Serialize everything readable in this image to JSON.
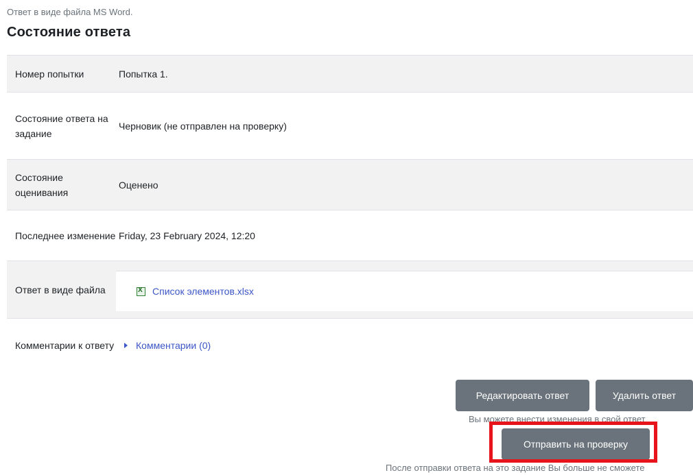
{
  "intro_text": "Ответ в виде файла MS Word.",
  "section_title": "Состояние ответа",
  "rows": {
    "attempt": {
      "label": "Номер попытки",
      "value": "Попытка 1."
    },
    "submission_status": {
      "label": "Состояние ответа на задание",
      "value": "Черновик (не отправлен на проверку)"
    },
    "grading_status": {
      "label": "Состояние оценивания",
      "value": "Оценено"
    },
    "last_modified": {
      "label": "Последнее изменение",
      "value": "Friday, 23 February 2024, 12:20"
    },
    "file_submission": {
      "label": "Ответ в виде файла",
      "file_name": "Список элементов.xlsx",
      "file_icon": "xlsx-file-icon"
    },
    "comments": {
      "label": "Комментарии к ответу",
      "link": "Комментарии (0)",
      "icon": "caret-right-icon"
    }
  },
  "buttons": {
    "edit": "Редактировать ответ",
    "delete": "Удалить ответ",
    "submit": "Отправить на проверку"
  },
  "hints": {
    "edit": "Вы можете внести изменения в свой ответ",
    "submit": "После отправки ответа на это задание Вы больше не сможете"
  },
  "colors": {
    "button_bg": "#6a737b",
    "link": "#3b55c7",
    "highlight": "#e8141c",
    "striped_row": "#f2f2f2"
  }
}
